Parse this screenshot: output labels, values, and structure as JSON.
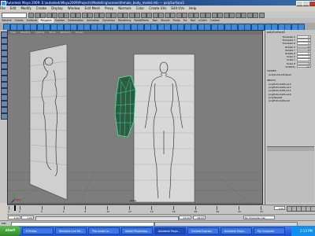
{
  "window": {
    "title": "Autodesk Maya 2009: E:\\autodesk\\Maya2009\\Projects\\Modelling\\scenes\\female_body_model.mb --- polySurface2"
  },
  "menubar": {
    "items": [
      "File",
      "Edit",
      "Modify",
      "Create",
      "Display",
      "Window",
      "Edit Mesh",
      "Proxy",
      "Normals",
      "Color",
      "Create UVs",
      "Edit UVs",
      "Help"
    ]
  },
  "shelf": {
    "tabs": [
      "General",
      "Curves",
      "Surfaces",
      "Polygons",
      "Subdivs",
      "Deformation",
      "Animation",
      "Dynamics",
      "Rendering",
      "PaintEffects",
      "Toon",
      "Muscle",
      "Fluids",
      "Fur",
      "Hair",
      "nCloth",
      "Custom"
    ]
  },
  "viewport": {
    "menu": [
      "View",
      "Shading",
      "Lighting",
      "Show",
      "Renderer",
      "Panels"
    ],
    "camera_label": "persp"
  },
  "channel_box": {
    "title": "polySurface2",
    "attributes": [
      {
        "label": "Translate X",
        "value": "0"
      },
      {
        "label": "Translate Y",
        "value": "0"
      },
      {
        "label": "Translate Z",
        "value": "0"
      },
      {
        "label": "Rotate X",
        "value": "0"
      },
      {
        "label": "Rotate Y",
        "value": "0"
      },
      {
        "label": "Rotate Z",
        "value": "0"
      },
      {
        "label": "Scale X",
        "value": "1"
      },
      {
        "label": "Scale Y",
        "value": "1"
      },
      {
        "label": "Scale Z",
        "value": "1"
      },
      {
        "label": "Visibility",
        "value": "on"
      }
    ],
    "shapes_header": "SHAPES",
    "shape_name": "polySurfaceShape2",
    "inputs_header": "INPUTS",
    "inputs": [
      "polyExtrudeFace13",
      "polyExtrudeFace12",
      "polyExtrudeFace11",
      "polyExtrudeFace10",
      "polyTweak2",
      "polyExtrudeFace9"
    ]
  },
  "timeslider": {
    "ticks": [
      "1",
      "2",
      "4",
      "6",
      "8",
      "10",
      "12",
      "14",
      "16",
      "18",
      "20",
      "22",
      "24"
    ],
    "current_frame": "1.00"
  },
  "range": {
    "start": "1.00",
    "inner_start": "1.00",
    "inner_end": "24.00",
    "end": "48.00",
    "char_set": "No Character Set"
  },
  "commandline": {
    "label": "MEL"
  },
  "taskbar": {
    "start": "start",
    "tasks": [
      "6 Firefox",
      "Windows Live Me...",
      "The model ia...",
      "Adobe Photoshop...",
      "Autodesk Maya...",
      "Outlook Express",
      "Autodesk Maya...",
      "My Computer"
    ],
    "clock": "2:13 PM"
  },
  "colors": {
    "viewport_bg": "#7d7d7d",
    "selection_green": "#3cff9a",
    "mesh_dark": "#2f5a43"
  }
}
